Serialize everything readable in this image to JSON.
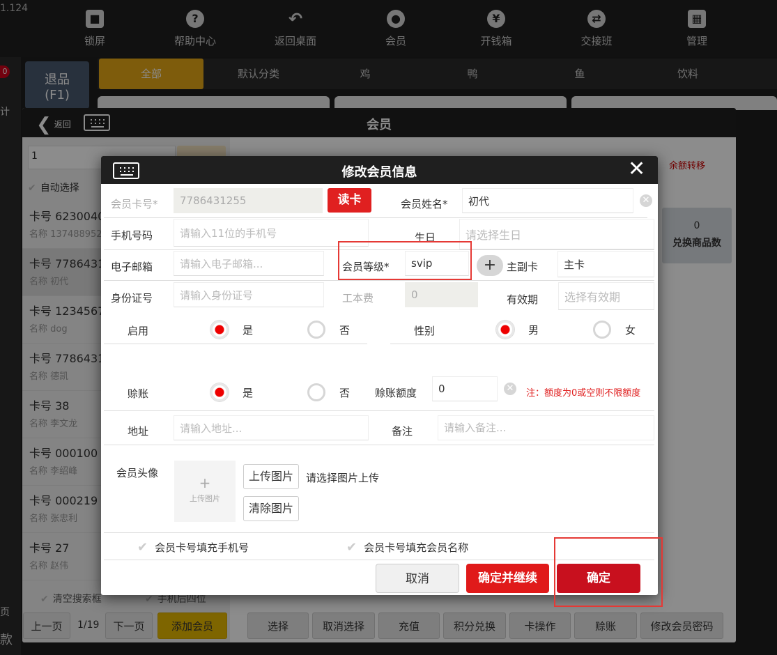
{
  "topbar": {
    "ip_fragment": "1.124",
    "buttons": [
      {
        "label": "锁屏",
        "icon": "lock-icon",
        "glyph": "🔒"
      },
      {
        "label": "帮助中心",
        "icon": "help-icon",
        "glyph": "?"
      },
      {
        "label": "返回桌面",
        "icon": "back-arrow-icon",
        "glyph": "↶"
      },
      {
        "label": "会员",
        "icon": "member-icon",
        "glyph": "◉"
      },
      {
        "label": "开钱箱",
        "icon": "money-bag-icon",
        "glyph": "¥"
      },
      {
        "label": "交接班",
        "icon": "shift-handover-icon",
        "glyph": "⇄"
      },
      {
        "label": "管理",
        "icon": "manage-grid-icon",
        "glyph": "▦"
      }
    ]
  },
  "pos": {
    "badge": "0",
    "left_strip_texts": [
      "计",
      "页",
      "款"
    ],
    "refund_label": "退品",
    "refund_key": "(F1)",
    "categories": [
      "全部",
      "默认分类",
      "鸡",
      "鸭",
      "鱼",
      "饮料"
    ],
    "active_category": "全部"
  },
  "member_window": {
    "title": "会员",
    "back_label": "返回",
    "search_value": "1",
    "auto_select_label": "自动选择",
    "members": [
      {
        "card": "卡号 6230040",
        "name": "名称 137488952"
      },
      {
        "card": "卡号 7786431",
        "name": "名称 初代"
      },
      {
        "card": "卡号 1234567",
        "name": "名称 dog"
      },
      {
        "card": "卡号 7786431",
        "name": "名称 德凯"
      },
      {
        "card": "卡号 38",
        "name": "名称 李文龙"
      },
      {
        "card": "卡号 000100",
        "name": "名称 李绍峰"
      },
      {
        "card": "卡号 000219",
        "name": "名称 张忠利"
      },
      {
        "card": "卡号 27",
        "name": "名称 赵伟"
      }
    ],
    "clear_search_label": "清空搜索框",
    "phone_last4_label": "手机后四位",
    "prev_page_label": "上一页",
    "page_indicator": "1/19",
    "next_page_label": "下一页",
    "add_member_label": "添加会员",
    "balance_transfer_label": "余额转移",
    "exchange_count_value": "0",
    "exchange_count_label": "兑换商品数",
    "bottom_buttons": [
      "选择",
      "取消选择",
      "充值",
      "积分兑换",
      "卡操作",
      "赊账",
      "修改会员密码"
    ]
  },
  "dialog": {
    "title": "修改会员信息",
    "fields": {
      "card_no_label": "会员卡号*",
      "card_no_value": "7786431255",
      "read_card_label": "读卡",
      "name_label": "会员姓名*",
      "name_value": "初代",
      "phone_label": "手机号码",
      "phone_placeholder": "请输入11位的手机号",
      "birthday_label": "生日",
      "birthday_placeholder": "请选择生日",
      "email_label": "电子邮箱",
      "email_placeholder": "请输入电子邮箱...",
      "level_label": "会员等级*",
      "level_value": "svip",
      "card_type_label": "主副卡",
      "card_type_value": "主卡",
      "id_label": "身份证号",
      "id_placeholder": "请输入身份证号",
      "cost_label": "工本费",
      "cost_value": "0",
      "expiry_label": "有效期",
      "expiry_placeholder": "选择有效期",
      "enable_label": "启用",
      "yes_label": "是",
      "no_label": "否",
      "gender_label": "性别",
      "male_label": "男",
      "female_label": "女",
      "credit_label": "赊账",
      "credit_limit_label": "赊账额度",
      "credit_limit_value": "0",
      "credit_note": "注：额度为0或空则不限额度",
      "address_label": "地址",
      "address_placeholder": "请输入地址...",
      "remark_label": "备注",
      "remark_placeholder": "请输入备注...",
      "avatar_label": "会员头像",
      "avatar_upload_text": "上传图片",
      "upload_button": "上传图片",
      "upload_hint": "请选择图片上传",
      "clear_image_button": "清除图片",
      "fill_phone_label": "会员卡号填充手机号",
      "fill_name_label": "会员卡号填充会员名称"
    },
    "enabled": "是",
    "gender": "男",
    "credit": "是",
    "buttons": {
      "cancel": "取消",
      "confirm_continue": "确定并继续",
      "confirm": "确定"
    }
  }
}
